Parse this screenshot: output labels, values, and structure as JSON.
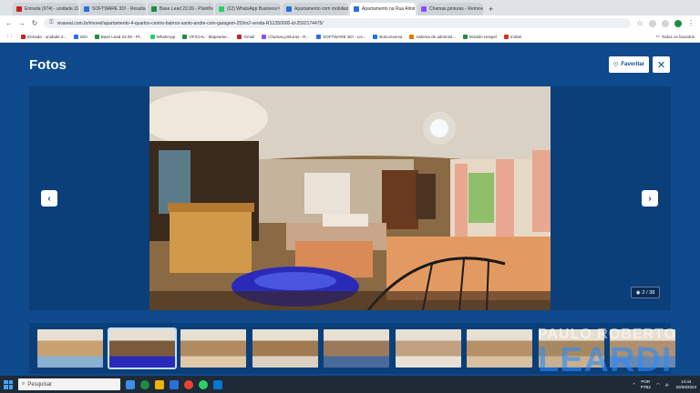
{
  "browser": {
    "tabs": [
      {
        "label": "Entrada (974) - unidade.22608@...",
        "color": "#c5221f",
        "active": false
      },
      {
        "label": "SOFTWARE 3D! - Resultado Fo...",
        "color": "#2a6fdb",
        "active": false
      },
      {
        "label": "Base Lead 22.09 - Planilhas G...",
        "color": "#1e8e3e",
        "active": false
      },
      {
        "label": "(22) WhatsApp Business",
        "color": "#25d366",
        "active": false
      },
      {
        "label": "Apartamento com mobiliado...",
        "color": "#2a6fdb",
        "active": false
      },
      {
        "label": "Apartamento na Rua Almirante...",
        "color": "#2a6fdb",
        "active": true
      },
      {
        "label": "Chamas.pinturas - Remove.bg",
        "color": "#8a4fff",
        "active": false
      }
    ],
    "new_tab": "+",
    "url": "vivareal.com.br/imovel/apartamento-4-quartos-centro-bairros-santo-andre-com-garagem-259m2-venda-RS1350000-id-2592174475/",
    "bookmarks": [
      {
        "label": "Entrada - unidade.2...",
        "color": "#c5221f"
      },
      {
        "label": "EDI",
        "color": "#2a6fdb"
      },
      {
        "label": "Base Lead 22.09 - Pl...",
        "color": "#1e8e3e"
      },
      {
        "label": "WhatsApp",
        "color": "#25d366"
      },
      {
        "label": "OFICIAL - Mapeame...",
        "color": "#1e8e3e"
      },
      {
        "label": "Gmail",
        "color": "#c5221f"
      },
      {
        "label": "Chamas.pinturas - R...",
        "color": "#8a4fff"
      },
      {
        "label": "SOFTWARE 3D! - Lis...",
        "color": "#2a6fdb"
      },
      {
        "label": "Botconversa",
        "color": "#1a73e8"
      },
      {
        "label": "sistema de administ...",
        "color": "#e37400"
      },
      {
        "label": "Módulo Hospel",
        "color": "#1e8e3e"
      },
      {
        "label": "mobei",
        "color": "#d93025"
      }
    ],
    "bookmarks_right": "Todos os favoritos"
  },
  "page": {
    "title": "Fotos",
    "favorite_label": "Favoritar",
    "close_glyph": "✕",
    "prev_glyph": "‹",
    "next_glyph": "›",
    "counter": "2 / 38",
    "watermark_line1": "PAULO ROBERTO",
    "watermark_line2": "LEARDI",
    "thumbnail_count": 9,
    "selected_thumbnail": 2
  },
  "taskbar": {
    "search_placeholder": "Pesquisar",
    "lang": "POR",
    "lang2": "PTB2",
    "time": "14:44",
    "date": "20/09/2023"
  }
}
